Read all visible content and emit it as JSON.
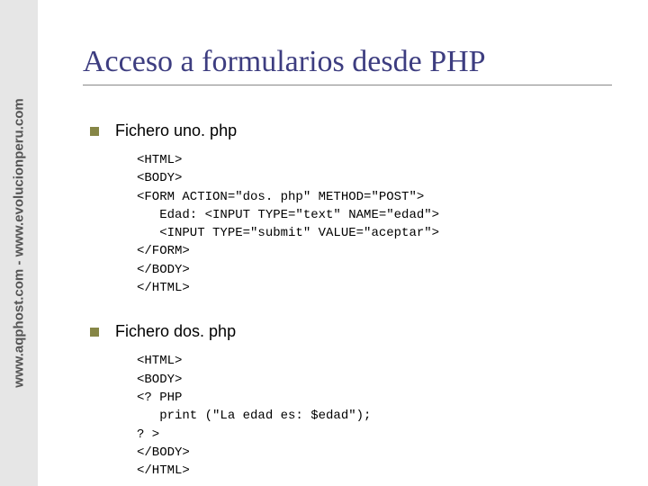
{
  "sidebar": {
    "text": "www.aqphost.com - www.evolucionperu.com"
  },
  "slide": {
    "title": "Acceso a formularios desde PHP"
  },
  "sections": [
    {
      "title": "Fichero uno. php",
      "code": "<HTML>\n<BODY>\n<FORM ACTION=\"dos. php\" METHOD=\"POST\">\n   Edad: <INPUT TYPE=\"text\" NAME=\"edad\">\n   <INPUT TYPE=\"submit\" VALUE=\"aceptar\">\n</FORM>\n</BODY>\n</HTML>"
    },
    {
      "title": "Fichero dos. php",
      "code": "<HTML>\n<BODY>\n<? PHP\n   print (\"La edad es: $edad\");\n? >\n</BODY>\n</HTML>"
    }
  ]
}
